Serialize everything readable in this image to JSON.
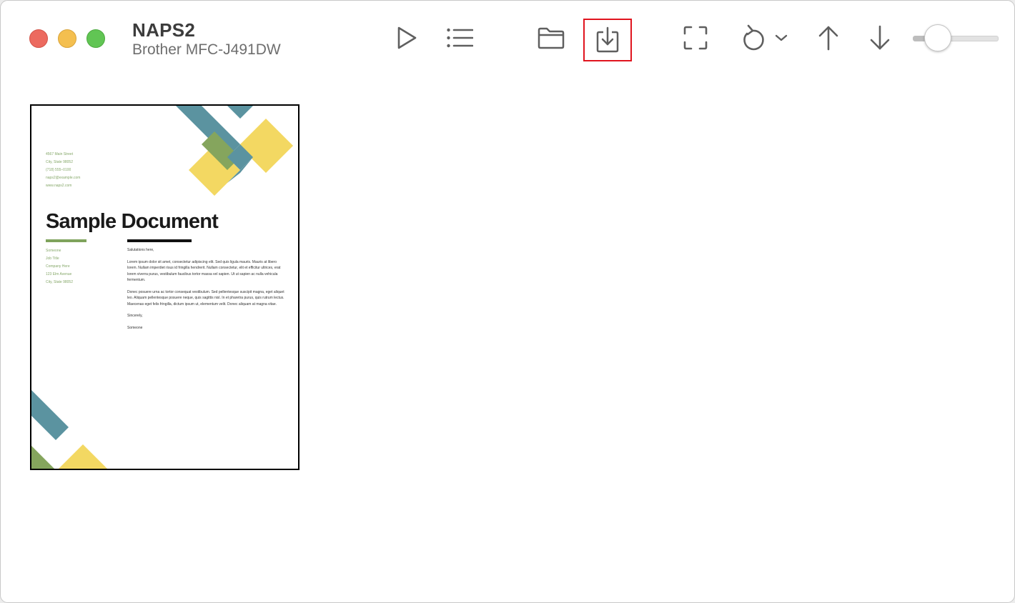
{
  "window": {
    "title": "NAPS2",
    "subtitle": "Brother MFC-J491DW"
  },
  "colors": {
    "close": "#ec6a5f",
    "minimize": "#f4bf4f",
    "maximize": "#61c554",
    "icon": "#5f5f5f",
    "highlight": "#e0141e",
    "deco_teal": "#5b93a0",
    "deco_green": "#85a55d",
    "deco_yellow": "#f3d862"
  },
  "toolbar": {
    "icons": [
      "play-icon",
      "list-icon",
      "folder-icon",
      "save-icon",
      "fullscreen-icon",
      "rotate-left-icon",
      "chevron-down-icon",
      "arrow-up-icon",
      "arrow-down-icon"
    ],
    "zoom_level": 0.2
  },
  "thumbnail": {
    "contact": [
      "4567 Main Street",
      "City, State 98052",
      "(718) 555–0100",
      "naps2@example.com",
      "www.naps2.com"
    ],
    "title": "Sample Document",
    "sender": [
      "Someone",
      "Job Title",
      "Company Here",
      "123 Elm Avenue",
      "City, State 98052"
    ],
    "salutation": "Salutations here,",
    "paragraph1": "Lorem ipsum dolor sit amet, consectetur adipiscing elit. Sed quis ligula mauris. Mauris at libero lorem. Nullam imperdiet risus id fringilla hendrerit. Nullam consectetur, elit et efficitur ultrices, erat lorem viverra purus, vestibulum faucibus tortor massa vel sapien. Ut ut sapien ac nulla vehicula fermentum.",
    "paragraph2": "Donec posuere urna ac tortor consequat vestibulum. Sed pellentesque suscipit magna, eget aliquet leo. Aliquam pellentesque posuere neque, quis sagittis nisl. In et pharetra purus, quis rutrum lectus. Maecenas eget felis fringilla, dictum ipsum ut, elementum velit. Donec aliquam at magna vitae.",
    "closing": "Sincerely,",
    "signature": "Someone"
  }
}
